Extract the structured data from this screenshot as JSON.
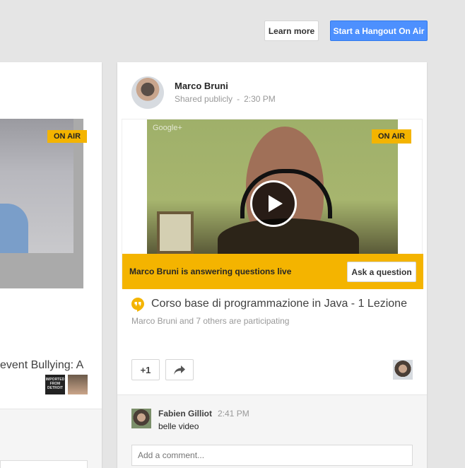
{
  "header": {
    "learn_more_label": "Learn more",
    "start_hangout_label": "Start a Hangout On Air"
  },
  "left_card": {
    "onair_label": "ON AIR",
    "title_fragment": "event Bullying: A",
    "avatar_badge_text": "IMPORTED FROM DETROIT"
  },
  "post": {
    "author": "Marco Bruni",
    "visibility": "Shared publicly",
    "separator": "-",
    "time": "2:30 PM",
    "video": {
      "watermark": "Google+",
      "onair_label": "ON AIR",
      "live_text": "Marco Bruni is answering questions live",
      "ask_button_label": "Ask a question"
    },
    "event_title": "Corso base di programmazione in Java - 1 Lezione",
    "participants_text": "Marco Bruni and 7 others are participating",
    "plus_one_label": "+1"
  },
  "comments": {
    "items": [
      {
        "author": "Fabien Gilliot",
        "time": "2:41 PM",
        "text": "belle video"
      }
    ],
    "input_placeholder": "Add a comment..."
  },
  "colors": {
    "accent_blue": "#4d90fe",
    "onair_yellow": "#f4b400",
    "background": "#e5e5e5"
  },
  "icons": [
    "play-icon",
    "hangout-quote-icon",
    "share-icon"
  ]
}
